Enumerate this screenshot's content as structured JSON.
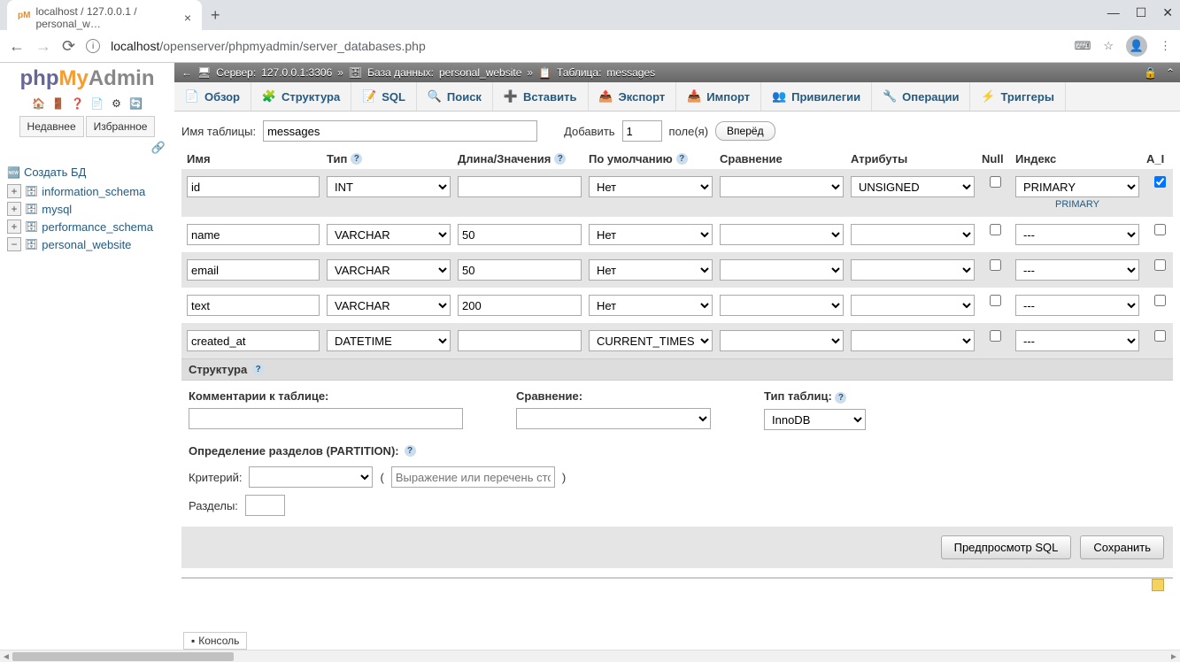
{
  "browser": {
    "tab_title": "localhost / 127.0.0.1 / personal_w…",
    "url_host": "localhost",
    "url_path": "/openserver/phpmyadmin/server_databases.php"
  },
  "logo": {
    "php": "php",
    "my": "My",
    "admin": "Admin"
  },
  "side": {
    "tabs": [
      "Недавнее",
      "Избранное"
    ],
    "create_db": "Создать БД",
    "dbs": [
      "information_schema",
      "mysql",
      "performance_schema",
      "personal_website"
    ]
  },
  "breadcrumb": {
    "server_label": "Сервер:",
    "server_value": "127.0.0.1:3306",
    "db_label": "База данных:",
    "db_value": "personal_website",
    "table_label": "Таблица:",
    "table_value": "messages"
  },
  "tabs": [
    "Обзор",
    "Структура",
    "SQL",
    "Поиск",
    "Вставить",
    "Экспорт",
    "Импорт",
    "Привилегии",
    "Операции",
    "Триггеры"
  ],
  "form": {
    "table_name_label": "Имя таблицы:",
    "table_name_value": "messages",
    "add_label": "Добавить",
    "add_count": "1",
    "fields_label": "поле(я)",
    "go_btn": "Вперёд"
  },
  "headers": {
    "name": "Имя",
    "type": "Тип",
    "length": "Длина/Значения",
    "default": "По умолчанию",
    "collation": "Сравнение",
    "attributes": "Атрибуты",
    "null": "Null",
    "index": "Индекс",
    "ai": "A_I"
  },
  "rows": [
    {
      "name": "id",
      "type": "INT",
      "length": "",
      "default": "Нет",
      "collation": "",
      "attr": "UNSIGNED",
      "null": false,
      "index": "PRIMARY",
      "primary_sub": "PRIMARY",
      "ai": true
    },
    {
      "name": "name",
      "type": "VARCHAR",
      "length": "50",
      "default": "Нет",
      "collation": "",
      "attr": "",
      "null": false,
      "index": "---",
      "primary_sub": "",
      "ai": false
    },
    {
      "name": "email",
      "type": "VARCHAR",
      "length": "50",
      "default": "Нет",
      "collation": "",
      "attr": "",
      "null": false,
      "index": "---",
      "primary_sub": "",
      "ai": false
    },
    {
      "name": "text",
      "type": "VARCHAR",
      "length": "200",
      "default": "Нет",
      "collation": "",
      "attr": "",
      "null": false,
      "index": "---",
      "primary_sub": "",
      "ai": false
    },
    {
      "name": "created_at",
      "type": "DATETIME",
      "length": "",
      "default": "CURRENT_TIMESTAMP",
      "collation": "",
      "attr": "",
      "null": false,
      "index": "---",
      "primary_sub": "",
      "ai": false
    }
  ],
  "structure": {
    "header": "Структура",
    "comments_label": "Комментарии к таблице:",
    "collation_label": "Сравнение:",
    "engine_label": "Тип таблиц:",
    "engine_value": "InnoDB"
  },
  "partition": {
    "label": "Определение разделов (PARTITION):",
    "criteria_label": "Критерий:",
    "expr_placeholder": "Выражение или перечень столбцов",
    "sections_label": "Разделы:"
  },
  "footer": {
    "preview": "Предпросмотр SQL",
    "save": "Сохранить"
  },
  "console": "Консоль"
}
